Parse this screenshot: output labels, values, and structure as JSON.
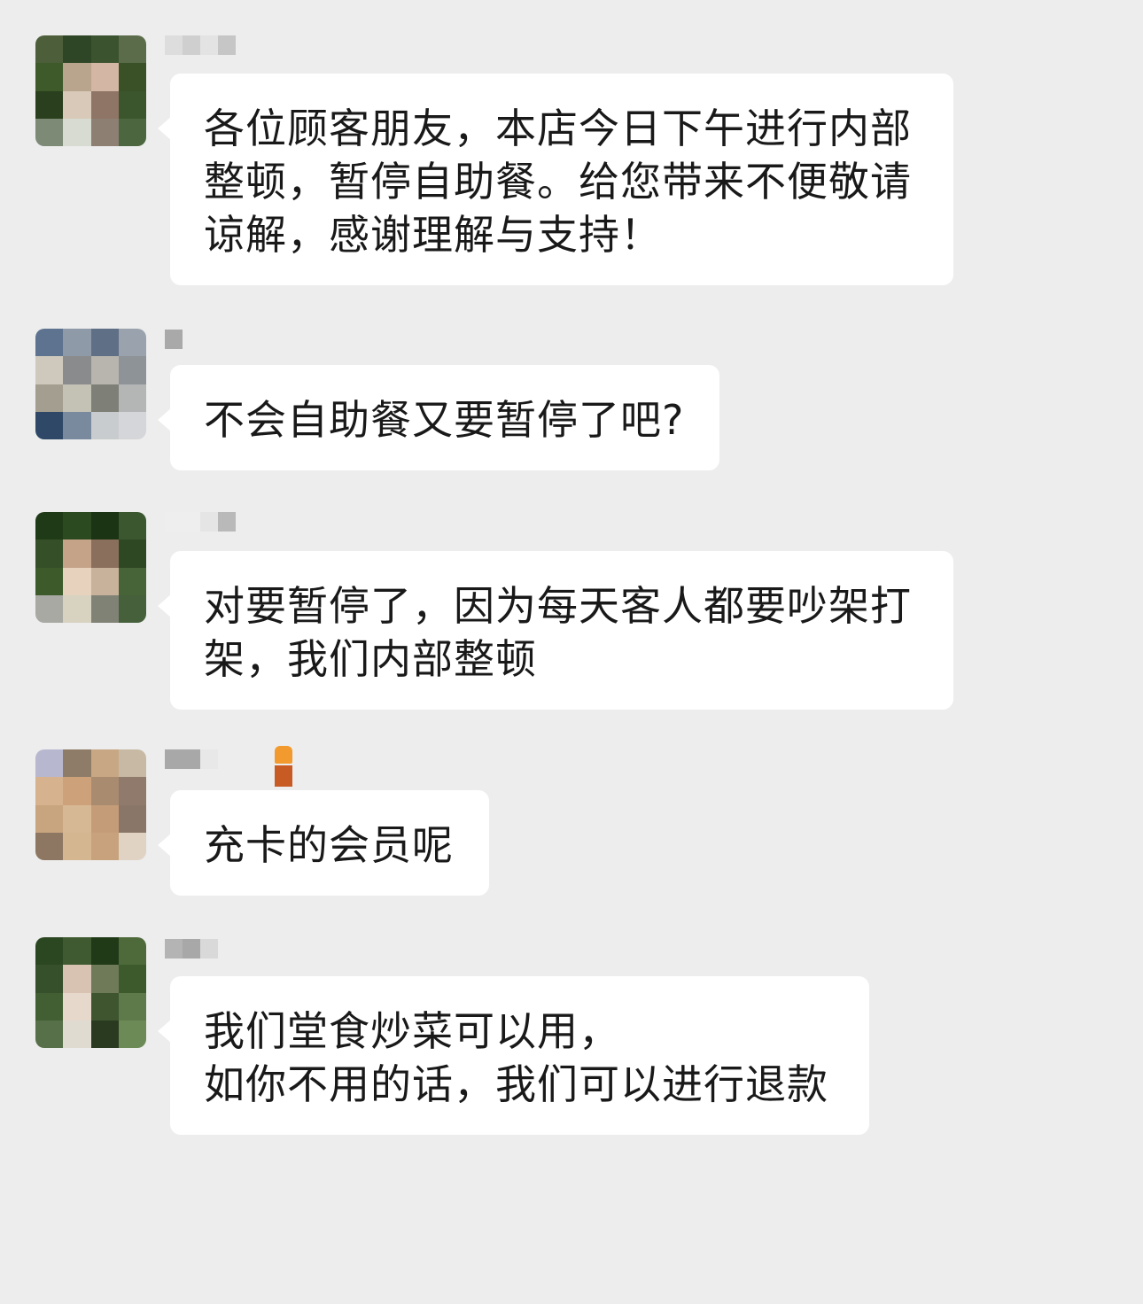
{
  "messages": [
    {
      "text": "各位顾客朋友，本店今日下午进行内部整顿，暂停自助餐。给您带来不便敬请谅解，感谢理解与支持！",
      "avatar_colors": [
        "#4c5e3a",
        "#2f4626",
        "#3c5330",
        "#5b6c4a",
        "#3f5a2a",
        "#b9a58e",
        "#d3b6a3",
        "#3a5026",
        "#2a3f1d",
        "#d8c9b8",
        "#8f7566",
        "#3b552c",
        "#7c8a76",
        "#d7dbd1",
        "#8d7f72",
        "#4c6640"
      ],
      "name_colors": [
        "#dddddd",
        "#cfcfcf",
        "#e3e3e3",
        "#c6c6c6"
      ]
    },
    {
      "text": "不会自助餐又要暂停了吧?",
      "avatar_colors": [
        "#5d7390",
        "#8f9aa9",
        "#5f6f85",
        "#9aa3ad",
        "#cfc8bd",
        "#8a8b8c",
        "#b7b5ae",
        "#8e9398",
        "#a39e8f",
        "#c4c1b5",
        "#7e7f77",
        "#b4b6b6",
        "#2f4868",
        "#7a8a9e",
        "#c9ccce",
        "#d5d6d9"
      ],
      "name_colors": [
        "#a9a9a9"
      ]
    },
    {
      "text": "对要暂停了，因为每天客人都要吵架打架，我们内部整顿",
      "avatar_colors": [
        "#1f3a17",
        "#2c4a1f",
        "#1b3414",
        "#3a5730",
        "#355029",
        "#c4a388",
        "#8a6f5c",
        "#2f4824",
        "#3c5a2a",
        "#e6d2bd",
        "#c9b29b",
        "#476438",
        "#a8a9a2",
        "#d8d2c1",
        "#7f8275",
        "#45603a"
      ],
      "name_colors": [
        "#eeeeee",
        "#e5e5e5",
        "#b9b9b9"
      ]
    },
    {
      "text": "充卡的会员呢",
      "avatar_colors": [
        "#b8b7d0",
        "#8f7c68",
        "#c8a884",
        "#c7b9a3",
        "#d6b28e",
        "#cda27b",
        "#a98c70",
        "#8f7a6b",
        "#c9a57f",
        "#d7b894",
        "#c59c78",
        "#8a7668",
        "#8d7763",
        "#d4b690",
        "#c7a27c",
        "#e1d3c4"
      ],
      "name_colors": [
        "#a8a8a8",
        "#e8e8e8"
      ]
    },
    {
      "text": "我们堂食炒菜可以用，\n如你不用的话，我们可以进行退款",
      "avatar_colors": [
        "#2b4721",
        "#3f5a30",
        "#203a17",
        "#4e6a3b",
        "#35502a",
        "#d8c2b1",
        "#6f7a59",
        "#3c5a2c",
        "#425f33",
        "#e6d8cb",
        "#3f5530",
        "#5e7a4b",
        "#577049",
        "#e0dbd1",
        "#2a3a20",
        "#6c8a55"
      ],
      "name_colors": [
        "#b4b4b4",
        "#a8a8a8",
        "#d9d9d9"
      ]
    }
  ]
}
